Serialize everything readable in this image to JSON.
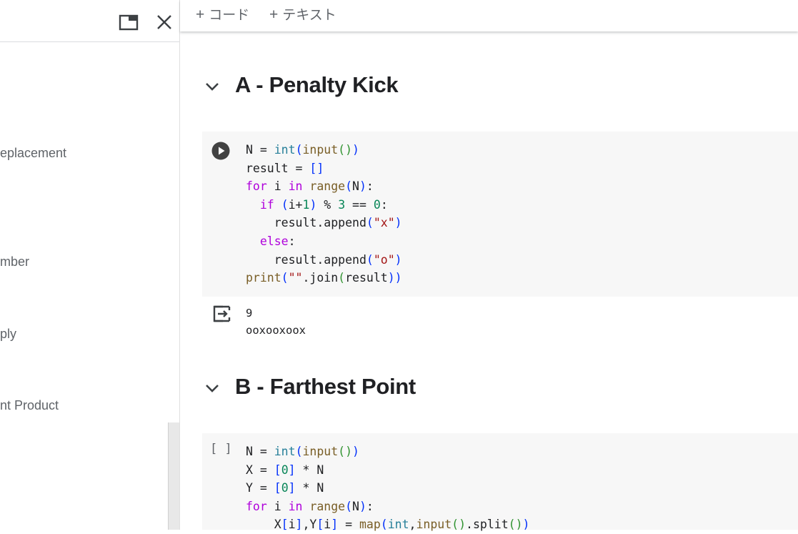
{
  "sidebar": {
    "items": [
      {
        "label": "eplacement"
      },
      {
        "label": "mber"
      },
      {
        "label": "ply"
      },
      {
        "label": "nt Product"
      }
    ]
  },
  "toolbar": {
    "add_code_label": "コード",
    "add_text_label": "テキスト"
  },
  "sections": [
    {
      "title": "A - Penalty Kick",
      "run_state": "play",
      "output": [
        "9",
        "ooxooxoox"
      ]
    },
    {
      "title": "B - Farthest Point",
      "run_state": "[ ]"
    }
  ],
  "code_cells": [
    [
      [
        [
          "N = ",
          ""
        ],
        [
          "int",
          "bi"
        ],
        [
          "(",
          "br1"
        ],
        [
          "input",
          "fn"
        ],
        [
          "()",
          "br2"
        ],
        [
          ")",
          "br1"
        ]
      ],
      [
        [
          "result = ",
          ""
        ],
        [
          "[]",
          "br1"
        ]
      ],
      [
        [
          "for",
          "kw"
        ],
        [
          " i ",
          ""
        ],
        [
          "in",
          "kw"
        ],
        [
          " ",
          ""
        ],
        [
          "range",
          "fn"
        ],
        [
          "(",
          "br1"
        ],
        [
          "N",
          ""
        ],
        [
          ")",
          "br1"
        ],
        [
          ":",
          ""
        ]
      ],
      [
        [
          "  ",
          ""
        ],
        [
          "if",
          "kw"
        ],
        [
          " ",
          ""
        ],
        [
          "(",
          "br1"
        ],
        [
          "i+",
          ""
        ],
        [
          "1",
          "num"
        ],
        [
          ")",
          "br1"
        ],
        [
          " % ",
          ""
        ],
        [
          "3",
          "num"
        ],
        [
          " == ",
          ""
        ],
        [
          "0",
          "num"
        ],
        [
          ":",
          ""
        ]
      ],
      [
        [
          "    result.append",
          ""
        ],
        [
          "(",
          "br1"
        ],
        [
          "\"x\"",
          "str"
        ],
        [
          ")",
          "br1"
        ]
      ],
      [
        [
          "  ",
          ""
        ],
        [
          "else",
          "kw"
        ],
        [
          ":",
          ""
        ]
      ],
      [
        [
          "    result.append",
          ""
        ],
        [
          "(",
          "br1"
        ],
        [
          "\"o\"",
          "str"
        ],
        [
          ")",
          "br1"
        ]
      ],
      [
        [
          "print",
          "fn"
        ],
        [
          "(",
          "br1"
        ],
        [
          "\"\"",
          "str"
        ],
        [
          ".join",
          ""
        ],
        [
          "(",
          "br2"
        ],
        [
          "result",
          ""
        ],
        [
          "))",
          "br1"
        ]
      ]
    ],
    [
      [
        [
          "N = ",
          ""
        ],
        [
          "int",
          "bi"
        ],
        [
          "(",
          "br1"
        ],
        [
          "input",
          "fn"
        ],
        [
          "()",
          "br2"
        ],
        [
          ")",
          "br1"
        ]
      ],
      [
        [
          "X = ",
          ""
        ],
        [
          "[",
          "br1"
        ],
        [
          "0",
          "num"
        ],
        [
          "]",
          "br1"
        ],
        [
          " * N",
          ""
        ]
      ],
      [
        [
          "Y = ",
          ""
        ],
        [
          "[",
          "br1"
        ],
        [
          "0",
          "num"
        ],
        [
          "]",
          "br1"
        ],
        [
          " * N",
          ""
        ]
      ],
      [
        [
          "for",
          "kw"
        ],
        [
          " i ",
          ""
        ],
        [
          "in",
          "kw"
        ],
        [
          " ",
          ""
        ],
        [
          "range",
          "fn"
        ],
        [
          "(",
          "br1"
        ],
        [
          "N",
          ""
        ],
        [
          ")",
          "br1"
        ],
        [
          ":",
          ""
        ]
      ],
      [
        [
          "    X",
          ""
        ],
        [
          "[",
          "br1"
        ],
        [
          "i",
          ""
        ],
        [
          "]",
          "br1"
        ],
        [
          ",Y",
          ""
        ],
        [
          "[",
          "br1"
        ],
        [
          "i",
          ""
        ],
        [
          "]",
          "br1"
        ],
        [
          " = ",
          ""
        ],
        [
          "map",
          "fn"
        ],
        [
          "(",
          "br1"
        ],
        [
          "int",
          "bi"
        ],
        [
          ",",
          ""
        ],
        [
          "input",
          "fn"
        ],
        [
          "()",
          "br2"
        ],
        [
          ".split",
          ""
        ],
        [
          "()",
          "br2"
        ],
        [
          ")",
          "br1"
        ]
      ]
    ]
  ]
}
